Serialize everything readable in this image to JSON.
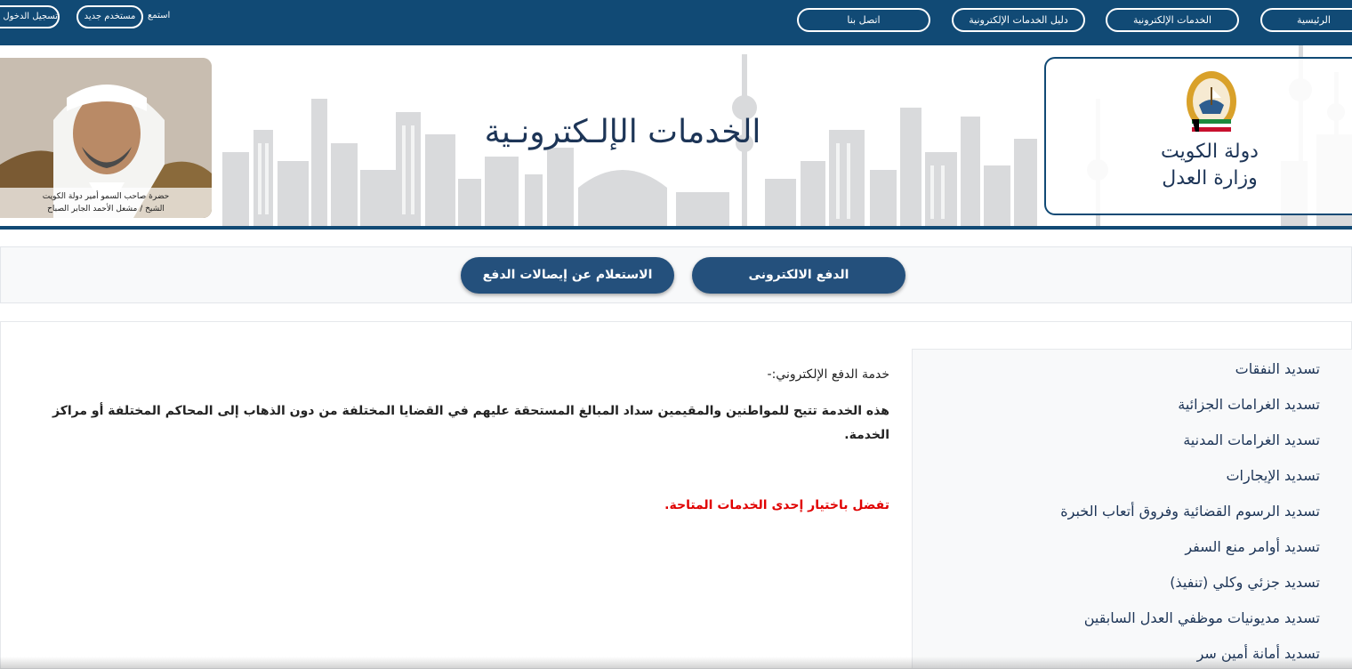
{
  "topnav": {
    "items": [
      {
        "label": "الرئيسية"
      },
      {
        "label": "الخدمات الإلكترونية"
      },
      {
        "label": "دليل الخدمات الإلكترونية"
      },
      {
        "label": "اتصل بنا"
      }
    ],
    "listen_label": "استمع",
    "new_user_label": "مستخدم جديد",
    "login_label": "تسجيل الدخول",
    "bg_color": "#114a75"
  },
  "banner": {
    "title": "الخدمات الإلـكترونـية",
    "ministry_line1": "دولة الكويت",
    "ministry_line2": "وزارة العدل",
    "portrait_caption_line1": "حضرة صاحب السمو أمير دولة الكويت",
    "portrait_caption_line2": "الشيخ / مشعل الأحمد الجابر الصباح"
  },
  "actions": {
    "pay_label": "الدفع الالكترونى",
    "inquiry_label": "الاستعلام عن إيصالات الدفع",
    "button_color": "#24507c"
  },
  "menu": {
    "items": [
      {
        "label": "تسديد النفقات"
      },
      {
        "label": "تسديد الغرامات الجزائية"
      },
      {
        "label": "تسديد الغرامات المدنية"
      },
      {
        "label": "تسديد الإيجارات"
      },
      {
        "label": "تسديد الرسوم القضائية وفروق أتعاب الخبرة"
      },
      {
        "label": "تسديد أوامر منع السفر"
      },
      {
        "label": "تسديد جزئي وكلي (تنفيذ)"
      },
      {
        "label": "تسديد مديونيات موظفي العدل السابقين"
      },
      {
        "label": "تسديد أمانة أمين سر"
      }
    ]
  },
  "content": {
    "title": "خدمة الدفع الإلكتروني:-",
    "body": "هذه الخدمة تتيح للمواطنين والمقيمين سداد المبالغ المستحقة عليهم في القضايا المختلفة من دون الذهاب إلى المحاكم المختلفة أو مراكز الخدمة.",
    "note": "تفضل باختيار إحدى الخدمات المتاحة.",
    "note_color": "#e00000"
  }
}
